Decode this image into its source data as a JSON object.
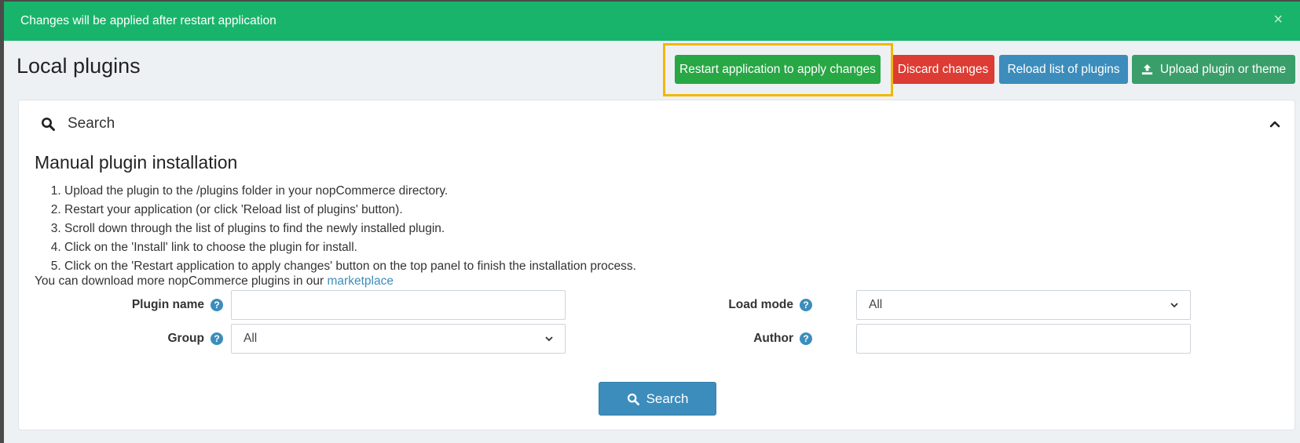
{
  "alert": {
    "message": "Changes will be applied after restart application",
    "close": "×"
  },
  "header": {
    "title": "Local plugins",
    "buttons": {
      "restart": "Restart application to apply changes",
      "discard": "Discard changes",
      "reload": "Reload list of plugins",
      "upload": "Upload plugin or theme"
    }
  },
  "search_panel": {
    "title": "Search",
    "manual_title": "Manual plugin installation",
    "steps": [
      "Upload the plugin to the /plugins folder in your nopCommerce directory.",
      "Restart your application (or click 'Reload list of plugins' button).",
      "Scroll down through the list of plugins to find the newly installed plugin.",
      "Click on the 'Install' link to choose the plugin for install.",
      "Click on the 'Restart application to apply changes' button on the top panel to finish the installation process."
    ],
    "more_text": "You can download more nopCommerce plugins in our ",
    "more_link": "marketplace",
    "fields": {
      "plugin_name_label": "Plugin name",
      "plugin_name_value": "",
      "group_label": "Group",
      "group_value": "All",
      "load_mode_label": "Load mode",
      "load_mode_value": "All",
      "author_label": "Author",
      "author_value": ""
    },
    "search_button": "Search"
  },
  "colors": {
    "alert_bg": "#19b46b",
    "restart_btn": "#28a745",
    "discard_btn": "#dc3c33",
    "reload_btn": "#3c8dbc",
    "upload_btn": "#3a9e6a",
    "highlight": "#f2b705",
    "link": "#3c8dbc"
  },
  "icons": {
    "search_header": "search-icon",
    "collapse": "chevron-up-icon",
    "upload": "upload-icon",
    "help": "question-circle-icon",
    "dropdown": "chevron-down-icon",
    "close": "close-icon"
  }
}
